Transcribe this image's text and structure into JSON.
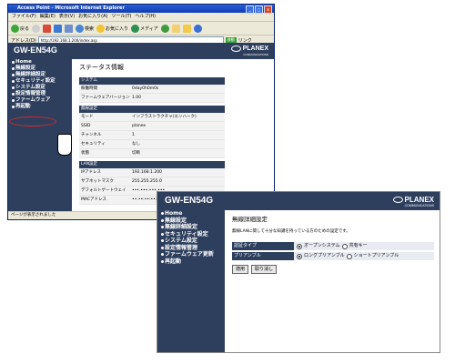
{
  "browser": {
    "title": "Access Point - Microsoft Internet Explorer",
    "menu": [
      "ファイル(F)",
      "編集(E)",
      "表示(V)",
      "お気に入り(A)",
      "ツール(T)",
      "ヘルプ(H)"
    ],
    "toolbar": [
      "戻る",
      "検索",
      "お気に入り",
      "メディア"
    ],
    "address_label": "アドレス(D)",
    "address_value": "http://192.168.1.200/index.asp",
    "go_label": "移動",
    "links_label": "リンク",
    "status_text": "ページが表示されました"
  },
  "router1": {
    "model": "GW-EN54G",
    "brand": "PLANEX",
    "brand_sub": "COMMUNICATIONS",
    "nav": [
      "Home",
      "無線設定",
      "無線詳細設定",
      "セキュリティ設定",
      "システム設定",
      "設定情報管理",
      "ファームウェア",
      "再起動"
    ],
    "heading": "ステータス情報",
    "sections": [
      {
        "title": "システム",
        "rows": [
          [
            "稼働時間",
            "0day0h0m0s"
          ],
          [
            "ファームウェアバージョン",
            "1.00"
          ]
        ]
      },
      {
        "title": "無線設定",
        "rows": [
          [
            "モード",
            "インフラストラクチャ(エンハーク)"
          ],
          [
            "SSID",
            "planex"
          ],
          [
            "チャンネル",
            "1"
          ],
          [
            "セキュリティ",
            "なし"
          ],
          [
            "状態",
            "切断"
          ]
        ]
      },
      {
        "title": "LAN設定",
        "rows": [
          [
            "IPアドレス",
            "192.168.1.200"
          ],
          [
            "サブネットマスク",
            "255.255.255.0"
          ],
          [
            "デフォルトゲートウェイ",
            "•••.•••.•••.•••"
          ],
          [
            "MACアドレス",
            "••:••:••:••:••:••"
          ]
        ]
      }
    ]
  },
  "router2": {
    "model": "GW-EN54G",
    "brand": "PLANEX",
    "brand_sub": "COMMUNICATIONS",
    "nav": [
      "Home",
      "無線設定",
      "無線詳細設定",
      "セキュリティ設定",
      "システム設定",
      "設定情報管理",
      "ファームウェア更新",
      "再起動"
    ],
    "heading": "無線詳細設定",
    "description": "無線LANに関して十分な知識を持っている方のための設定です。",
    "options": [
      {
        "label": "認証タイプ",
        "choices": [
          "オープンシステム",
          "共有キー"
        ],
        "selected": 0
      },
      {
        "label": "プリアンブル",
        "choices": [
          "ロングプリアンブル",
          "ショートプリアンブル"
        ],
        "selected": 0
      }
    ],
    "apply_label": "適用",
    "cancel_label": "取り消し"
  },
  "colors": {
    "nav_bg": "#2e3f5e",
    "highlight_circle": "#cc2b2b"
  }
}
